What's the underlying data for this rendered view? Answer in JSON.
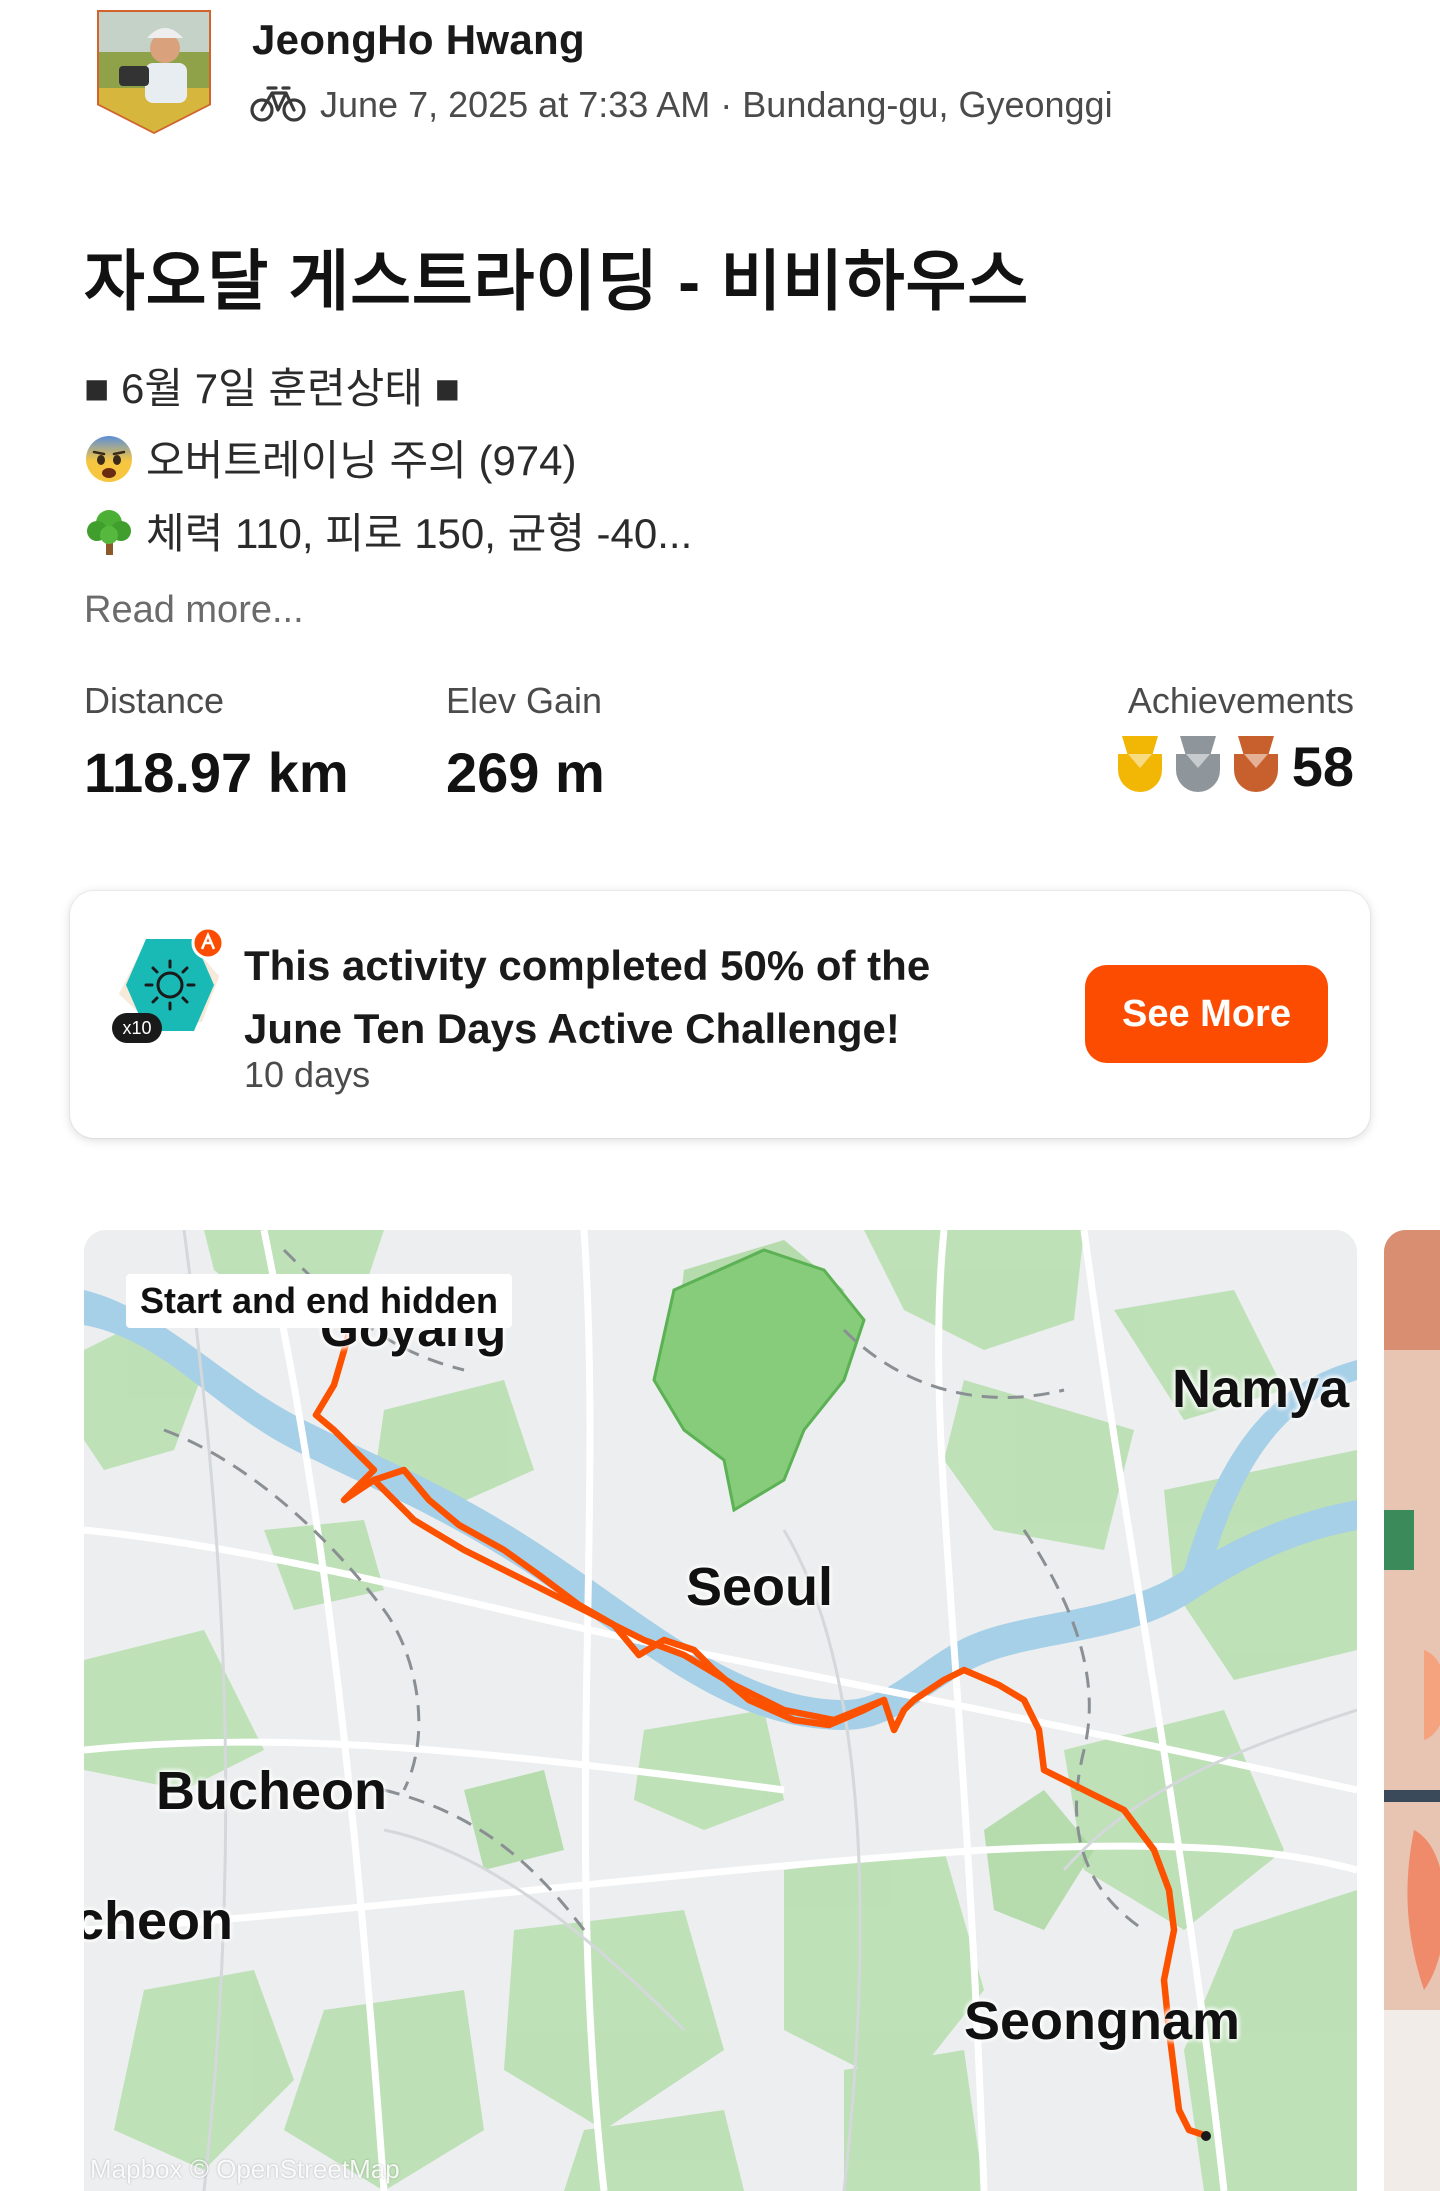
{
  "header": {
    "user_name": "JeongHo Hwang",
    "activity_icon": "bike-icon",
    "meta": "June 7, 2025 at 7:33 AM · Bundang-gu, Gyeonggi"
  },
  "activity": {
    "title": "자오달 게스트라이딩 - 비비하우스",
    "description": [
      "■ 6월 7일 훈련상태 ■",
      "오버트레이닝 주의 (974)",
      "체력 110, 피로 150, 균형 -40..."
    ],
    "description_icons": [
      "",
      "fearful-face-emoji",
      "tree-emoji"
    ],
    "read_more": "Read more..."
  },
  "stats": {
    "distance_label": "Distance",
    "distance_value": "118.97 km",
    "elev_label": "Elev Gain",
    "elev_value": "269 m",
    "achievements_label": "Achievements",
    "achievements_count": "58",
    "medals": [
      "gold-medal-icon",
      "silver-medal-icon",
      "bronze-medal-icon"
    ]
  },
  "challenge": {
    "title": "This activity completed 50% of the June Ten Days Active Challenge!",
    "subtitle": "10 days",
    "badge_multiplier": "x10",
    "button_label": "See More",
    "completion_percent": 50
  },
  "map": {
    "hidden_label": "Start and end hidden",
    "labels": {
      "goyang": "Goyang",
      "namyang": "Namya",
      "seoul": "Seoul",
      "bucheon": "Bucheon",
      "incheon": "cheon",
      "seongnam": "Seongnam"
    },
    "attribution": "Mapbox © OpenStreetMap"
  },
  "colors": {
    "accent": "#fc4c02",
    "route": "#fc5200",
    "gold": "#f2b705",
    "silver": "#8e969b",
    "bronze": "#c8602d"
  }
}
